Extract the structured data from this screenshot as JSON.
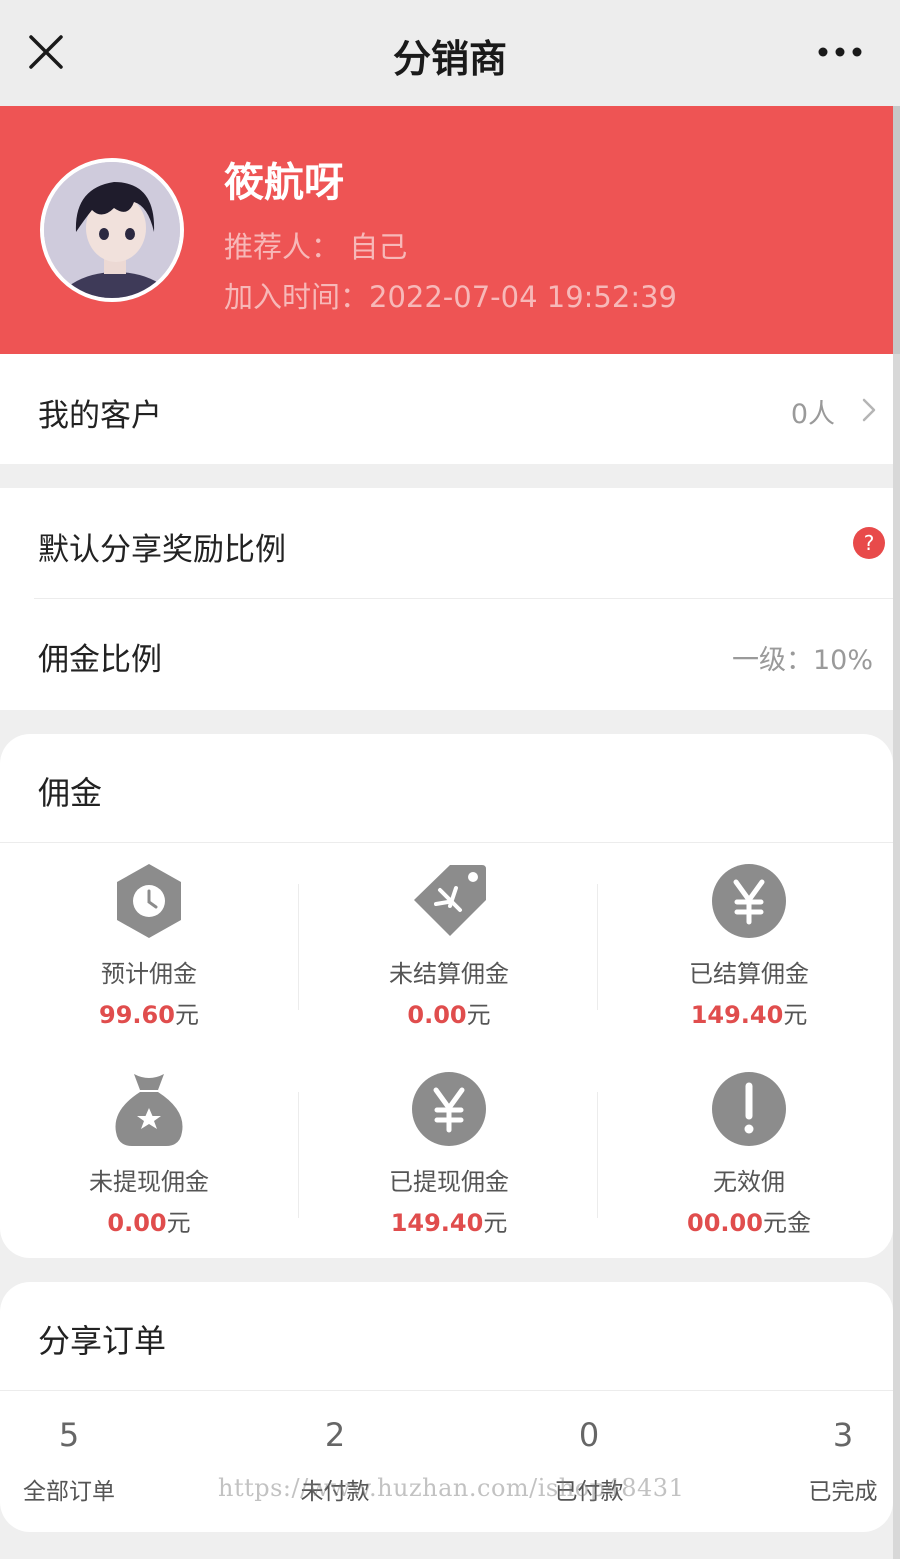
{
  "header": {
    "title": "分销商"
  },
  "profile": {
    "name": "筱航呀",
    "referrer": "推荐人：  自己",
    "join_time": "加入时间：2022-07-04 19:52:39"
  },
  "customers": {
    "label": "我的客户",
    "value": "0人"
  },
  "share_ratio": {
    "label": "默认分享奖励比例"
  },
  "commission_ratio": {
    "label": "佣金比例",
    "value": "一级：10%"
  },
  "commission": {
    "title": "佣金",
    "items": [
      {
        "label": "预计佣金",
        "amount": "99.60",
        "unit": "元",
        "icon": "clock-icon"
      },
      {
        "label": "未结算佣金",
        "amount": "0.00",
        "unit": "元",
        "icon": "price-tag-icon"
      },
      {
        "label": "已结算佣金",
        "amount": "149.40",
        "unit": "元",
        "icon": "yen-icon"
      },
      {
        "label": "未提现佣金",
        "amount": "0.00",
        "unit": "元",
        "icon": "money-bag-icon"
      },
      {
        "label": "已提现佣金",
        "amount": "149.40",
        "unit": "元",
        "icon": "yen-icon"
      },
      {
        "label": "无效佣",
        "amount": "00.00",
        "unit": "元金",
        "icon": "exclamation-icon"
      }
    ]
  },
  "orders": {
    "title": "分享订单",
    "stats": [
      {
        "count": "5",
        "label": "全部订单"
      },
      {
        "count": "2",
        "label": "未付款"
      },
      {
        "count": "0",
        "label": "已付款"
      },
      {
        "count": "3",
        "label": "已完成"
      }
    ]
  },
  "watermark": "https://www.huzhan.com/ishop48431",
  "colors": {
    "brand_red": "#ee5454",
    "amount_red": "#e04d4d",
    "icon_gray": "#8c8c8c",
    "help_red": "#e84a4a"
  }
}
